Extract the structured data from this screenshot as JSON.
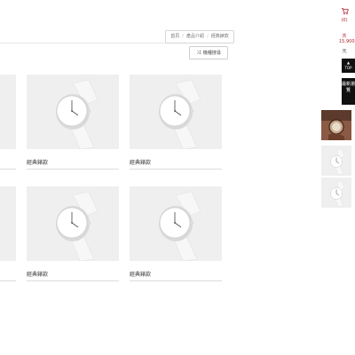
{
  "breadcrumb": {
    "items": [
      "首頁",
      "產品介紹",
      "經典錶款"
    ]
  },
  "toolbar": {
    "switch_label": "機種搜尋",
    "switch_icon": "shuffle-icon"
  },
  "products": [
    {
      "name": "經典錶款"
    },
    {
      "name": "經典錶款"
    },
    {
      "name": "經典錶款"
    },
    {
      "name": "經典錶款"
    },
    {
      "name": "經典錶款"
    },
    {
      "name": "經典錶款"
    }
  ],
  "sidebar": {
    "cart_icon": "cart-icon",
    "cart_count": "(0)",
    "cart_label": "共",
    "cart_total": "15,900",
    "cart_unit": "元",
    "top_label": "TOP",
    "recent_label": "最新瀏覽",
    "accent_color": "#b0222f"
  }
}
